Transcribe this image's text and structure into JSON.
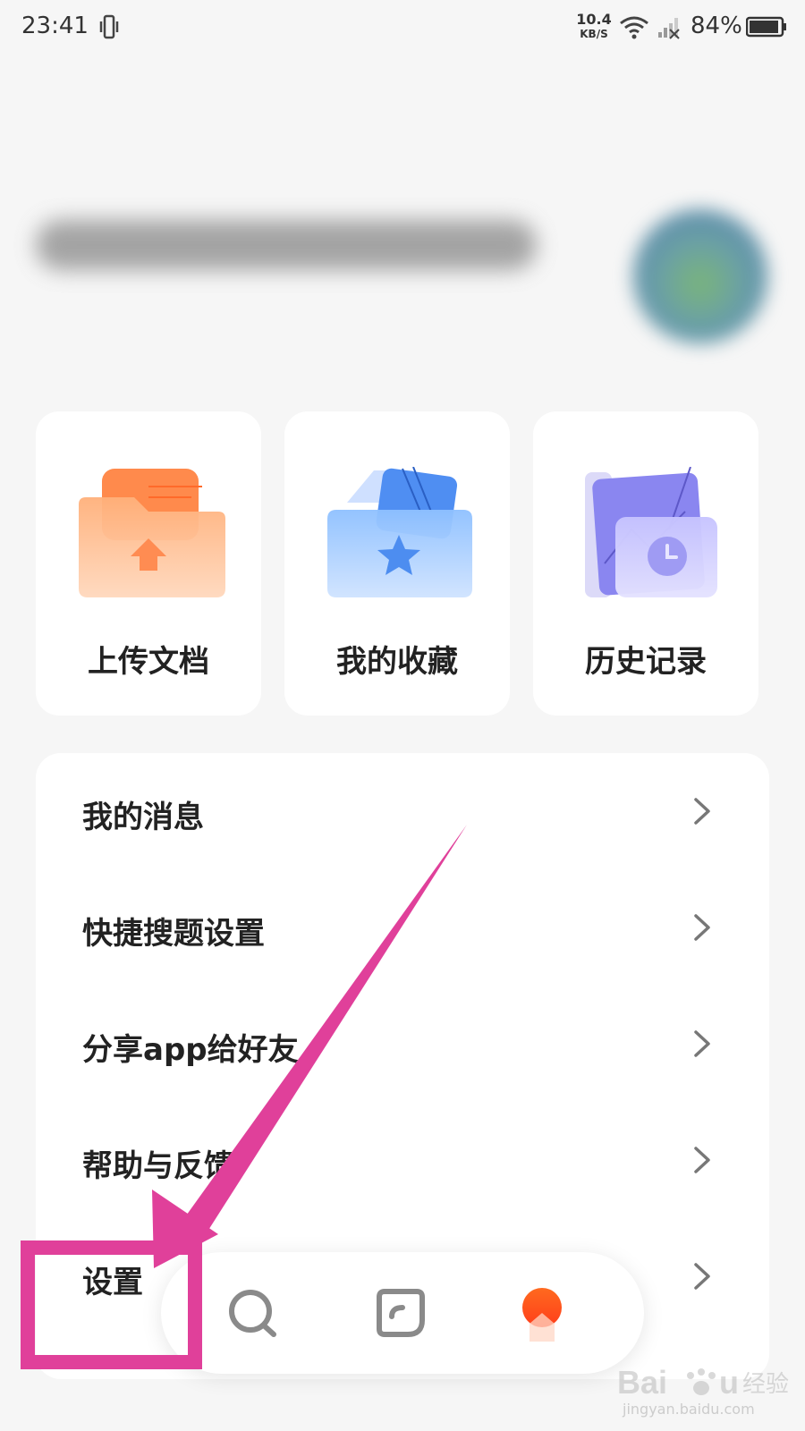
{
  "status_bar": {
    "time": "23:41",
    "net_speed": "10.4",
    "net_speed_unit": "KB/S",
    "battery_percent": "84%",
    "icons": [
      "vibrate-icon",
      "wifi-icon",
      "signal-icon",
      "battery-icon"
    ]
  },
  "quick_actions": [
    {
      "label": "上传文档",
      "icon": "upload-folder-icon",
      "color": "#ff8a4c"
    },
    {
      "label": "我的收藏",
      "icon": "favorites-folder-icon",
      "color": "#5b9cf5"
    },
    {
      "label": "历史记录",
      "icon": "history-folder-icon",
      "color": "#8a86f0"
    }
  ],
  "menu": {
    "items": [
      {
        "label": "我的消息"
      },
      {
        "label": "快捷搜题设置"
      },
      {
        "label": "分享app给好友"
      },
      {
        "label": "帮助与反馈"
      },
      {
        "label": "设置"
      }
    ]
  },
  "bottom_nav": {
    "items": [
      {
        "icon": "search-icon"
      },
      {
        "icon": "notes-icon"
      },
      {
        "icon": "profile-sun-icon",
        "active": true
      }
    ],
    "active_color": "#ff5a1f"
  },
  "annotation": {
    "color": "#e0409a"
  },
  "watermark": {
    "text": "jingyan.baidu.com"
  }
}
